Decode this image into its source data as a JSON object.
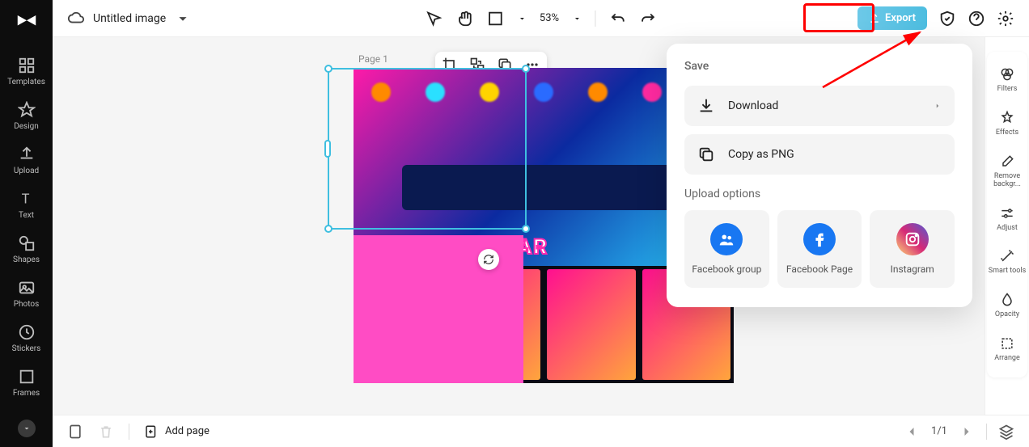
{
  "header": {
    "doc_title": "Untitled image",
    "zoom": "53%",
    "export_label": "Export"
  },
  "left_rail": {
    "items": [
      {
        "label": "Templates"
      },
      {
        "label": "Design"
      },
      {
        "label": "Upload"
      },
      {
        "label": "Text"
      },
      {
        "label": "Shapes"
      },
      {
        "label": "Photos"
      },
      {
        "label": "Stickers"
      },
      {
        "label": "Frames"
      }
    ]
  },
  "canvas": {
    "page_label": "Page 1",
    "artwork_text": "NIGHT PAR"
  },
  "popover": {
    "save_heading": "Save",
    "download_label": "Download",
    "copy_png_label": "Copy as PNG",
    "upload_heading": "Upload options",
    "upload_options": [
      {
        "label": "Facebook group",
        "color": "#1877f2"
      },
      {
        "label": "Facebook Page",
        "color": "#1877f2"
      },
      {
        "label": "Instagram",
        "color": "linear-gradient(45deg,#feda75,#d62976,#4f5bd5)"
      }
    ]
  },
  "right_rail": {
    "items": [
      {
        "label": "Filters"
      },
      {
        "label": "Effects"
      },
      {
        "label": "Remove backgr..."
      },
      {
        "label": "Adjust"
      },
      {
        "label": "Smart tools"
      },
      {
        "label": "Opacity"
      },
      {
        "label": "Arrange"
      }
    ]
  },
  "bottom": {
    "add_page": "Add page",
    "page_indicator": "1/1"
  }
}
